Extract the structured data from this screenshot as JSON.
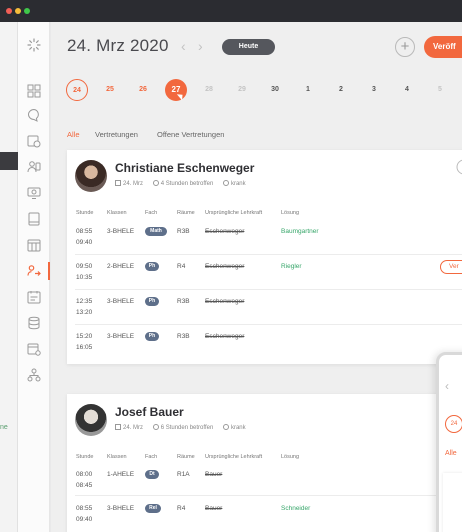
{
  "header": {
    "date": "24. Mrz 2020",
    "prev_arrow": "‹",
    "next_arrow": "›",
    "today_label": "Heute",
    "add_label": "+",
    "publish_label": "Veröff"
  },
  "calendar": {
    "days": [
      "24",
      "25",
      "26",
      "27",
      "28",
      "29",
      "30",
      "1",
      "2",
      "3",
      "4",
      "5"
    ],
    "selected": "27"
  },
  "filters": [
    "Alle",
    "Vertretungen",
    "Offene Vertretungen"
  ],
  "columns": [
    "Stunde",
    "Klassen",
    "Fach",
    "Räume",
    "Ursprüngliche Lehrkraft",
    "Lösung"
  ],
  "cards": [
    {
      "name": "Christiane Eschenweger",
      "date": "24. Mrz",
      "hours": "4 Stunden betroffen",
      "reason": "krank",
      "rows": [
        {
          "time1": "08:55",
          "time2": "09:40",
          "klasse": "3-BHELE",
          "fach": "Math",
          "raum": "R3B",
          "original": "Eschenweger",
          "loesung": "Baumgartner",
          "action": ""
        },
        {
          "time1": "09:50",
          "time2": "10:35",
          "klasse": "2-BHELE",
          "fach": "Ph",
          "raum": "R4",
          "original": "Eschenweger",
          "loesung": "Riegler",
          "action": "Ver"
        },
        {
          "time1": "12:35",
          "time2": "13:20",
          "klasse": "3-BHELE",
          "fach": "Ph",
          "raum": "R3B",
          "original": "Eschenweger",
          "loesung": "",
          "action": ""
        },
        {
          "time1": "15:20",
          "time2": "16:05",
          "klasse": "3-BHELE",
          "fach": "Ph",
          "raum": "R3B",
          "original": "Eschenweger",
          "loesung": "",
          "action": ""
        }
      ]
    },
    {
      "name": "Josef Bauer",
      "date": "24. Mrz",
      "hours": "6 Stunden betroffen",
      "reason": "krank",
      "rows": [
        {
          "time1": "08:00",
          "time2": "08:45",
          "klasse": "1-AHELE",
          "fach": "Dt",
          "raum": "R1A",
          "original": "Bauer",
          "loesung": "",
          "action": ""
        },
        {
          "time1": "08:55",
          "time2": "09:40",
          "klasse": "3-BHELE",
          "fach": "Rel",
          "raum": "R4",
          "original": "Bauer",
          "loesung": "Schneider",
          "action": ""
        }
      ]
    }
  ],
  "left_hint": "ne",
  "overlay": {
    "back": "‹",
    "day": "24",
    "filter": "Alle"
  },
  "colors": {
    "accent": "#f2683e",
    "green": "#37a66a",
    "dark": "#2b2c31"
  }
}
